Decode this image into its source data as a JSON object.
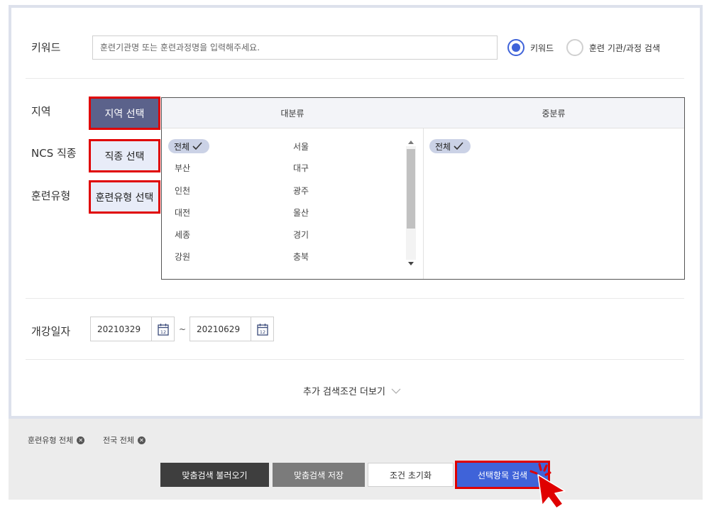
{
  "keyword": {
    "label": "키워드",
    "placeholder": "훈련기관명 또는 훈련과정명을 입력해주세요.",
    "radio_keyword": "키워드",
    "radio_org": "훈련 기관/과정 검색"
  },
  "filters": {
    "region_label": "지역",
    "region_button": "지역 선택",
    "ncs_label": "NCS 직종",
    "ncs_button": "직종 선택",
    "type_label": "훈련유형",
    "type_button": "훈련유형 선택"
  },
  "panel": {
    "major_header": "대분류",
    "minor_header": "중분류",
    "major_col1": [
      "전체",
      "부산",
      "인천",
      "대전",
      "세종",
      "강원"
    ],
    "major_col2": [
      "서울",
      "대구",
      "광주",
      "울산",
      "경기",
      "충북"
    ],
    "minor_items": [
      "전체"
    ]
  },
  "dates": {
    "label": "개강일자",
    "start": "20210329",
    "end": "20210629",
    "separator": "~",
    "calendar_day": "12"
  },
  "more": {
    "label": "추가 검색조건 더보기"
  },
  "selected_tags": [
    "훈련유형 전체",
    "전국 전체"
  ],
  "buttons": {
    "load": "맞춤검색 불러오기",
    "save": "맞춤검색 저장",
    "reset": "조건 초기화",
    "search": "선택항목 검색"
  },
  "colors": {
    "accent": "#3f63d9",
    "highlight": "#e00000",
    "active_button": "#5b628b",
    "chip": "#cbd2e6"
  }
}
